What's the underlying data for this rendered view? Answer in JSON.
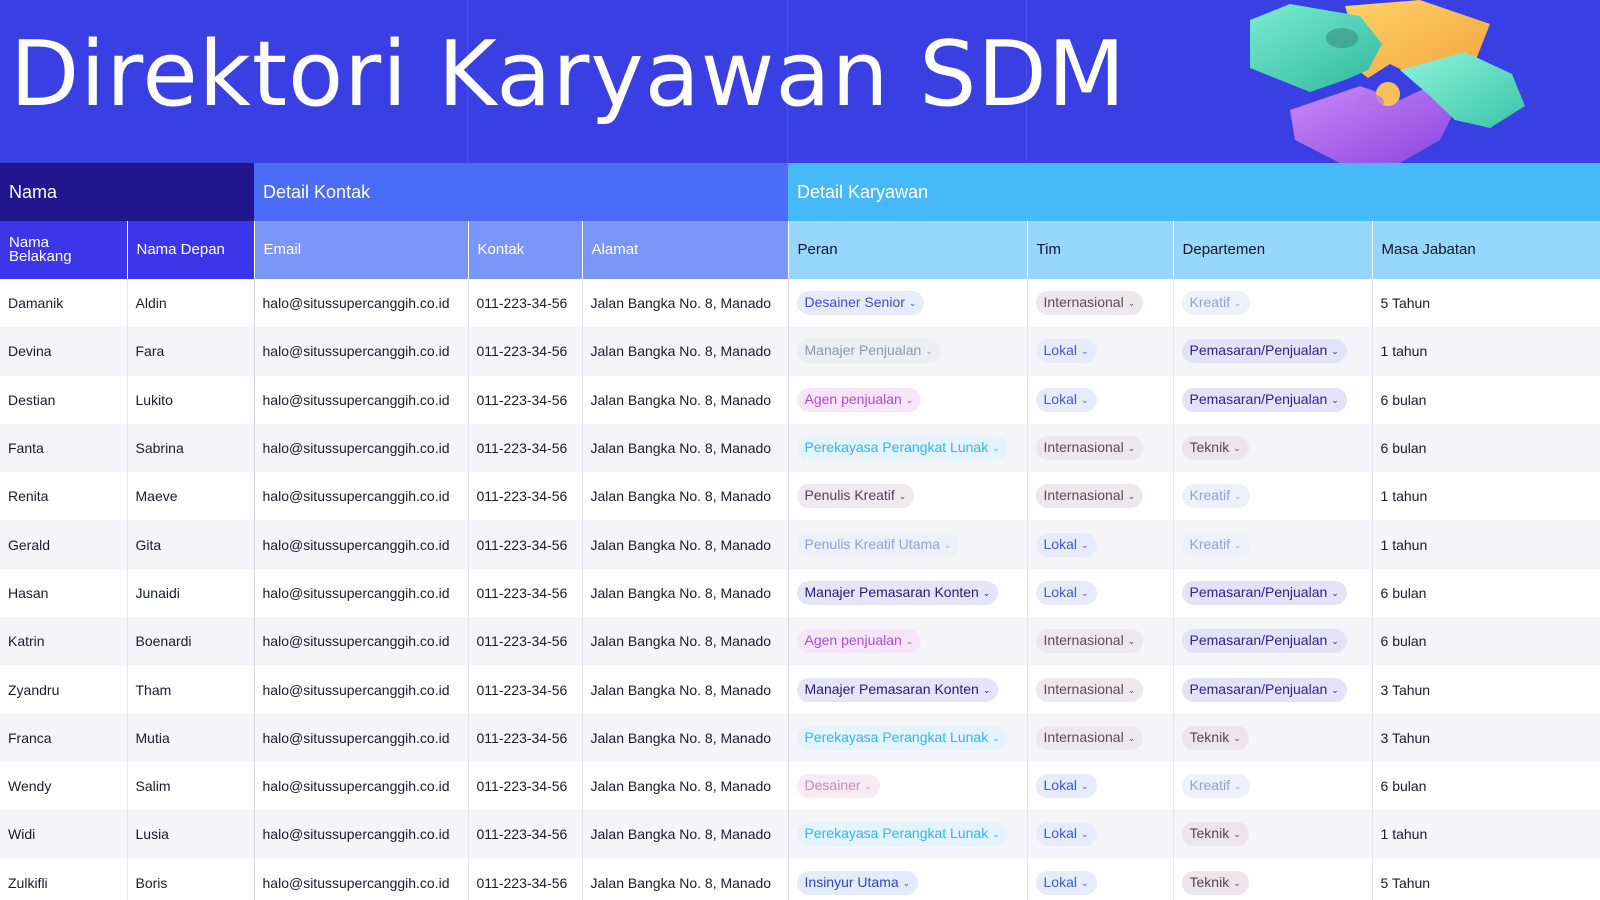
{
  "title": "Direktori Karyawan SDM",
  "header_groups": {
    "nama": "Nama",
    "kontak": "Detail Kontak",
    "karyawan": "Detail Karyawan"
  },
  "columns": {
    "nama_belakang": "Nama Belakang",
    "nama_depan": "Nama Depan",
    "email": "Email",
    "kontak": "Kontak",
    "alamat": "Alamat",
    "peran": "Peran",
    "tim": "Tim",
    "departemen": "Departemen",
    "masa_jabatan": "Masa Jabatan"
  },
  "rows": [
    {
      "last": "Damanik",
      "first": "Aldin",
      "email": "halo@situssupercanggih.co.id",
      "phone": "011-223-34-56",
      "address": "Jalan Bangka No. 8, Manado",
      "role": "Desainer Senior",
      "role_style": "r-desainer-senior",
      "team": "Internasional",
      "team_style": "t-internasional",
      "dept": "Kreatif",
      "dept_style": "d-kreatif",
      "tenure": "5 Tahun"
    },
    {
      "last": "Devina",
      "first": "Fara",
      "email": "halo@situssupercanggih.co.id",
      "phone": "011-223-34-56",
      "address": "Jalan Bangka No. 8, Manado",
      "role": "Manajer Penjualan",
      "role_style": "r-manajer-penjualan",
      "team": "Lokal",
      "team_style": "t-lokal",
      "dept": "Pemasaran/Penjualan",
      "dept_style": "d-pemasaran",
      "tenure": "1 tahun"
    },
    {
      "last": "Destian",
      "first": "Lukito",
      "email": "halo@situssupercanggih.co.id",
      "phone": "011-223-34-56",
      "address": "Jalan Bangka No. 8, Manado",
      "role": "Agen penjualan",
      "role_style": "r-agen-penjualan",
      "team": "Lokal",
      "team_style": "t-lokal",
      "dept": "Pemasaran/Penjualan",
      "dept_style": "d-pemasaran",
      "tenure": "6 bulan"
    },
    {
      "last": "Fanta",
      "first": "Sabrina",
      "email": "halo@situssupercanggih.co.id",
      "phone": "011-223-34-56",
      "address": "Jalan Bangka No. 8, Manado",
      "role": "Perekayasa Perangkat Lunak",
      "role_style": "r-perekayasa",
      "team": "Internasional",
      "team_style": "t-internasional",
      "dept": "Teknik",
      "dept_style": "d-teknik",
      "tenure": "6 bulan"
    },
    {
      "last": "Renita",
      "first": "Maeve",
      "email": "halo@situssupercanggih.co.id",
      "phone": "011-223-34-56",
      "address": "Jalan Bangka No. 8, Manado",
      "role": "Penulis Kreatif",
      "role_style": "r-penulis-kreatif",
      "team": "Internasional",
      "team_style": "t-internasional",
      "dept": "Kreatif",
      "dept_style": "d-kreatif",
      "tenure": "1 tahun"
    },
    {
      "last": "Gerald",
      "first": "Gita",
      "email": "halo@situssupercanggih.co.id",
      "phone": "011-223-34-56",
      "address": "Jalan Bangka No. 8, Manado",
      "role": "Penulis Kreatif Utama",
      "role_style": "r-penulis-utama",
      "team": "Lokal",
      "team_style": "t-lokal",
      "dept": "Kreatif",
      "dept_style": "d-kreatif",
      "tenure": "1 tahun"
    },
    {
      "last": "Hasan",
      "first": "Junaidi",
      "email": "halo@situssupercanggih.co.id",
      "phone": "011-223-34-56",
      "address": "Jalan Bangka No. 8, Manado",
      "role": "Manajer Pemasaran Konten",
      "role_style": "r-manajer-konten",
      "team": "Lokal",
      "team_style": "t-lokal",
      "dept": "Pemasaran/Penjualan",
      "dept_style": "d-pemasaran",
      "tenure": "6 bulan"
    },
    {
      "last": "Katrin",
      "first": "Boenardi",
      "email": "halo@situssupercanggih.co.id",
      "phone": "011-223-34-56",
      "address": "Jalan Bangka No. 8, Manado",
      "role": "Agen penjualan",
      "role_style": "r-agen-penjualan",
      "team": "Internasional",
      "team_style": "t-internasional",
      "dept": "Pemasaran/Penjualan",
      "dept_style": "d-pemasaran",
      "tenure": "6 bulan"
    },
    {
      "last": "Zyandru",
      "first": "Tham",
      "email": "halo@situssupercanggih.co.id",
      "phone": "011-223-34-56",
      "address": "Jalan Bangka No. 8, Manado",
      "role": "Manajer Pemasaran Konten",
      "role_style": "r-manajer-konten",
      "team": "Internasional",
      "team_style": "t-internasional",
      "dept": "Pemasaran/Penjualan",
      "dept_style": "d-pemasaran",
      "tenure": "3 Tahun"
    },
    {
      "last": "Franca",
      "first": "Mutia",
      "email": "halo@situssupercanggih.co.id",
      "phone": "011-223-34-56",
      "address": "Jalan Bangka No. 8, Manado",
      "role": "Perekayasa Perangkat Lunak",
      "role_style": "r-perekayasa",
      "team": "Internasional",
      "team_style": "t-internasional",
      "dept": "Teknik",
      "dept_style": "d-teknik",
      "tenure": "3 Tahun"
    },
    {
      "last": "Wendy",
      "first": "Salim",
      "email": "halo@situssupercanggih.co.id",
      "phone": "011-223-34-56",
      "address": "Jalan Bangka No. 8, Manado",
      "role": "Desainer",
      "role_style": "r-desainer",
      "team": "Lokal",
      "team_style": "t-lokal",
      "dept": "Kreatif",
      "dept_style": "d-kreatif",
      "tenure": "6 bulan"
    },
    {
      "last": "Widi",
      "first": "Lusia",
      "email": "halo@situssupercanggih.co.id",
      "phone": "011-223-34-56",
      "address": "Jalan Bangka No. 8, Manado",
      "role": "Perekayasa Perangkat Lunak",
      "role_style": "r-perekayasa",
      "team": "Lokal",
      "team_style": "t-lokal",
      "dept": "Teknik",
      "dept_style": "d-teknik",
      "tenure": "1 tahun"
    },
    {
      "last": "Zulkifli",
      "first": "Boris",
      "email": "halo@situssupercanggih.co.id",
      "phone": "011-223-34-56",
      "address": "Jalan Bangka No. 8, Manado",
      "role": "Insinyur Utama",
      "role_style": "r-insinyur",
      "team": "Lokal",
      "team_style": "t-lokal",
      "dept": "Teknik",
      "dept_style": "d-teknik",
      "tenure": "5 Tahun"
    }
  ],
  "colors": {
    "hero_bg": "#3a3fe3",
    "group_nama": "#22168f",
    "group_kontak": "#4a6cf6",
    "group_karyawan": "#47b8f8"
  },
  "icons": {
    "decoration": "puzzle-pieces-icon",
    "dropdown": "chevron-down-icon"
  }
}
